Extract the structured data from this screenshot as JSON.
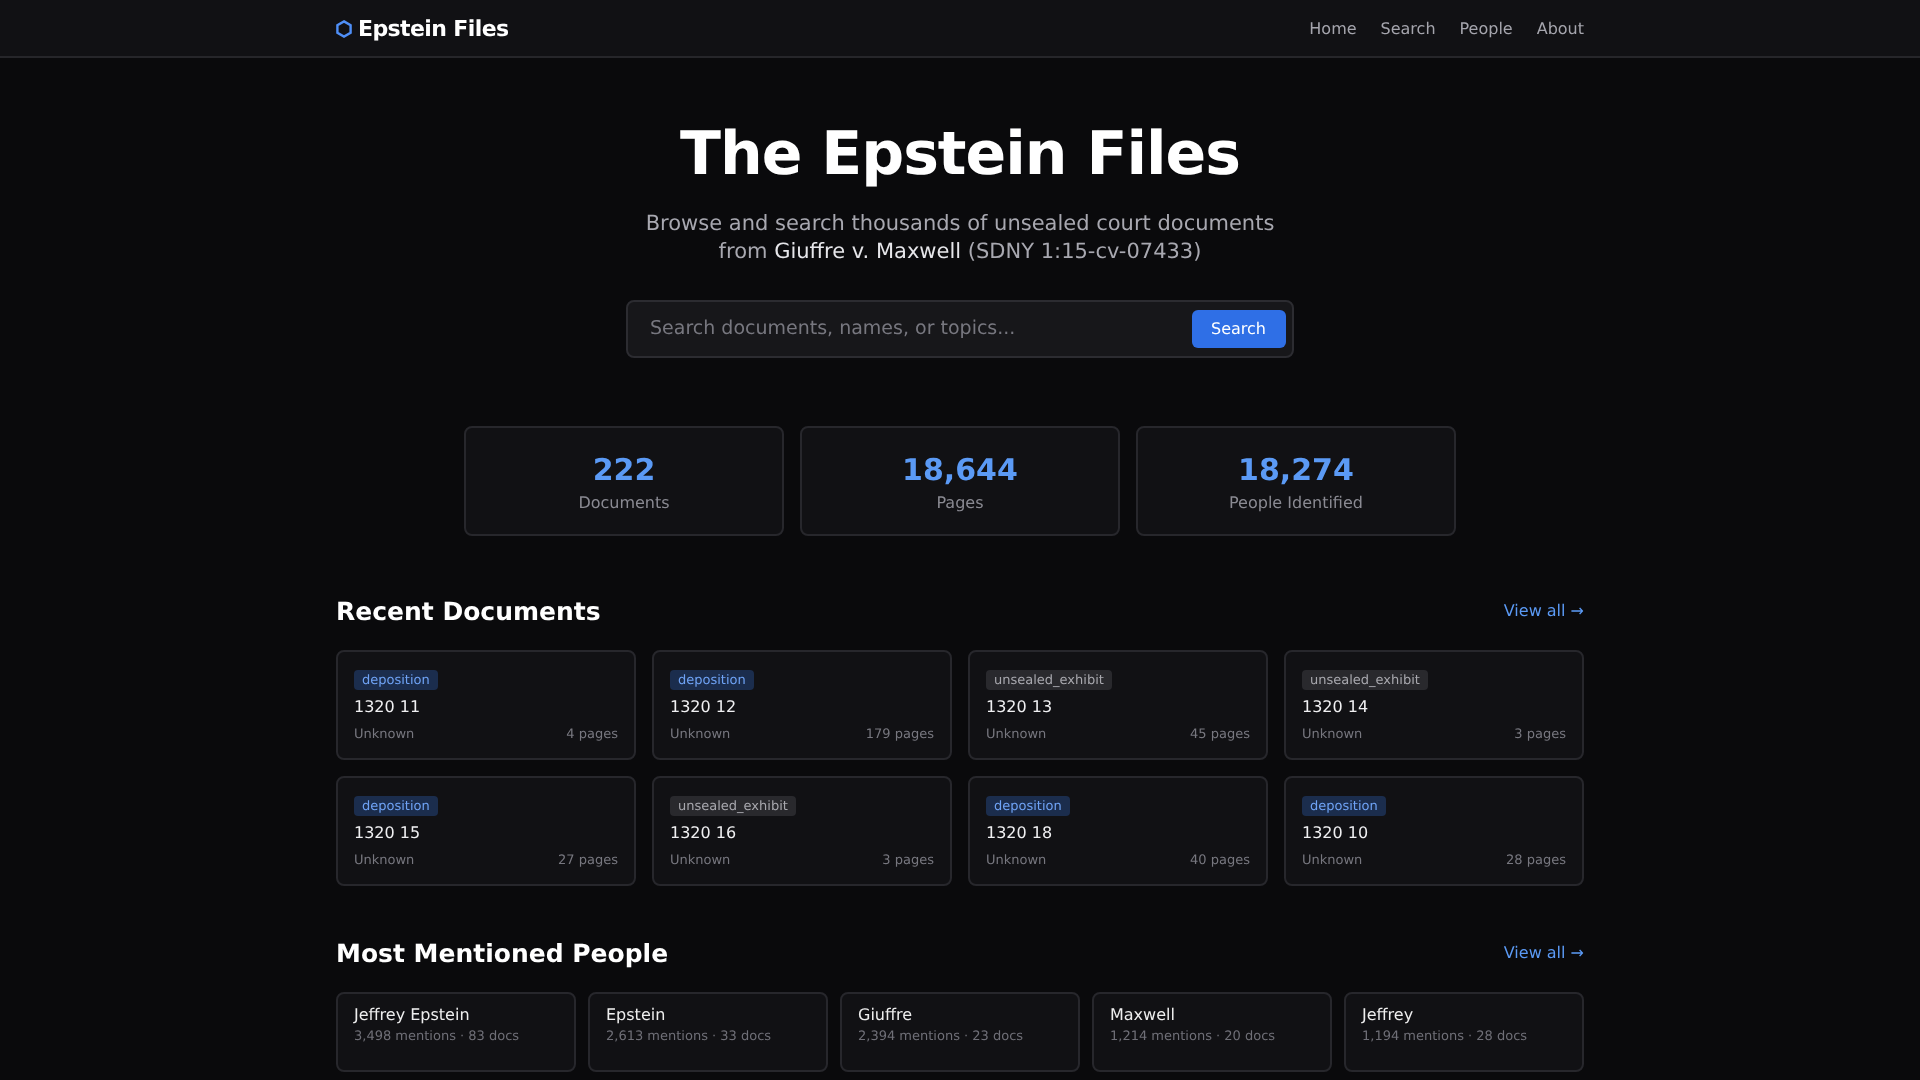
{
  "nav": {
    "brand": "Epstein Files",
    "links": [
      "Home",
      "Search",
      "People",
      "About"
    ]
  },
  "hero": {
    "title": "The Epstein Files",
    "subtitle": "Browse and search thousands of unsealed court documents from **Giuffre v. Maxwell** (SDNY 1:15-cv-07433)"
  },
  "search": {
    "placeholder": "Search documents, names, or topics...",
    "button": "Search"
  },
  "stats": [
    {
      "value": "222",
      "label": "Documents"
    },
    {
      "value": "18,644",
      "label": "Pages"
    },
    {
      "value": "18,274",
      "label": "People Identified"
    }
  ],
  "recent_documents": {
    "heading": "Recent Documents",
    "view_all": "View all →",
    "items": [
      {
        "kind": "deposition",
        "tag": "deposition",
        "title": "1320 11",
        "date": "Unknown",
        "pages": "4 pages"
      },
      {
        "kind": "deposition",
        "tag": "deposition",
        "title": "1320 12",
        "date": "Unknown",
        "pages": "179 pages"
      },
      {
        "kind": "exhibit",
        "tag": "unsealed_exhibit",
        "title": "1320 13",
        "date": "Unknown",
        "pages": "45 pages"
      },
      {
        "kind": "exhibit",
        "tag": "unsealed_exhibit",
        "title": "1320 14",
        "date": "Unknown",
        "pages": "3 pages"
      },
      {
        "kind": "deposition",
        "tag": "deposition",
        "title": "1320 15",
        "date": "Unknown",
        "pages": "27 pages"
      },
      {
        "kind": "exhibit",
        "tag": "unsealed_exhibit",
        "title": "1320 16",
        "date": "Unknown",
        "pages": "3 pages"
      },
      {
        "kind": "deposition",
        "tag": "deposition",
        "title": "1320 18",
        "date": "Unknown",
        "pages": "40 pages"
      },
      {
        "kind": "deposition",
        "tag": "deposition",
        "title": "1320 10",
        "date": "Unknown",
        "pages": "28 pages"
      }
    ]
  },
  "people": {
    "heading": "Most Mentioned People",
    "view_all": "View all →",
    "items": [
      {
        "name": "Jeffrey Epstein",
        "stats": "3,498 mentions · 83 docs"
      },
      {
        "name": "Epstein",
        "stats": "2,613 mentions · 33 docs"
      },
      {
        "name": "Giuffre",
        "stats": "2,394 mentions · 23 docs"
      },
      {
        "name": "Maxwell",
        "stats": "1,214 mentions · 20 docs"
      },
      {
        "name": "Jeffrey",
        "stats": "1,194 mentions · 28 docs"
      }
    ]
  }
}
